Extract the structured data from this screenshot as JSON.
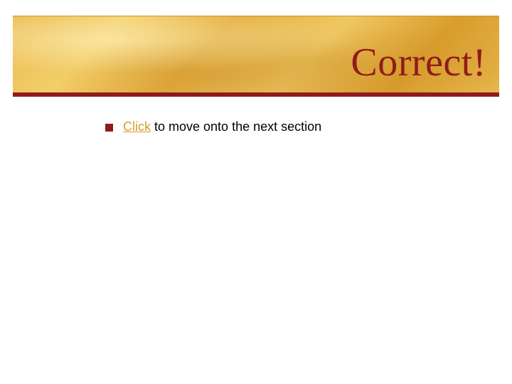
{
  "header": {
    "title": "Correct!"
  },
  "content": {
    "bullet": {
      "link_text": "Click",
      "rest_text": " to move onto the next section"
    }
  },
  "colors": {
    "accent": "#8f1c1c",
    "link": "#d89a2b",
    "band_base": "#e9b84c"
  }
}
